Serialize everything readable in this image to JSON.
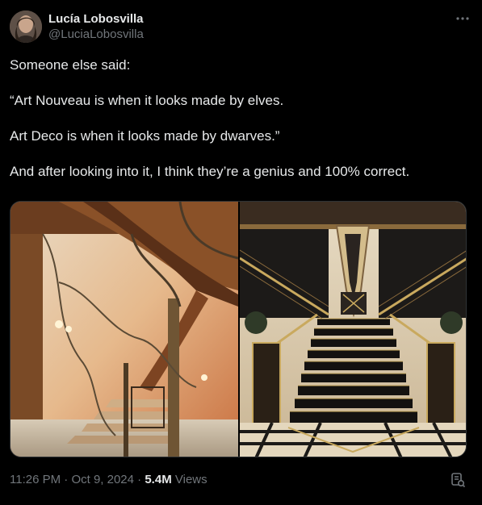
{
  "author": {
    "display_name": "Lucía Lobosvilla",
    "handle": "@LuciaLobosvilla",
    "avatar_icon": "avatar-photo"
  },
  "more_icon": "more-horizontal-icon",
  "post": {
    "lines": [
      "Someone else said:",
      "“Art Nouveau is when it looks made by elves.",
      "Art Deco is when it looks made by dwarves.”",
      "And after looking into it, I think they’re a genius and 100% correct."
    ]
  },
  "media": {
    "left_image": "art-nouveau-staircase",
    "right_image": "art-deco-staircase"
  },
  "meta": {
    "time": "11:26 PM",
    "sep1": "·",
    "date": "Oct 9, 2024",
    "sep2": "·",
    "views_count": "5.4M",
    "views_label": "Views"
  },
  "analytics_icon": "bookmark-analytics-icon",
  "colors": {
    "background": "#000000",
    "text_primary": "#e7e9ea",
    "text_secondary": "#71767b"
  }
}
